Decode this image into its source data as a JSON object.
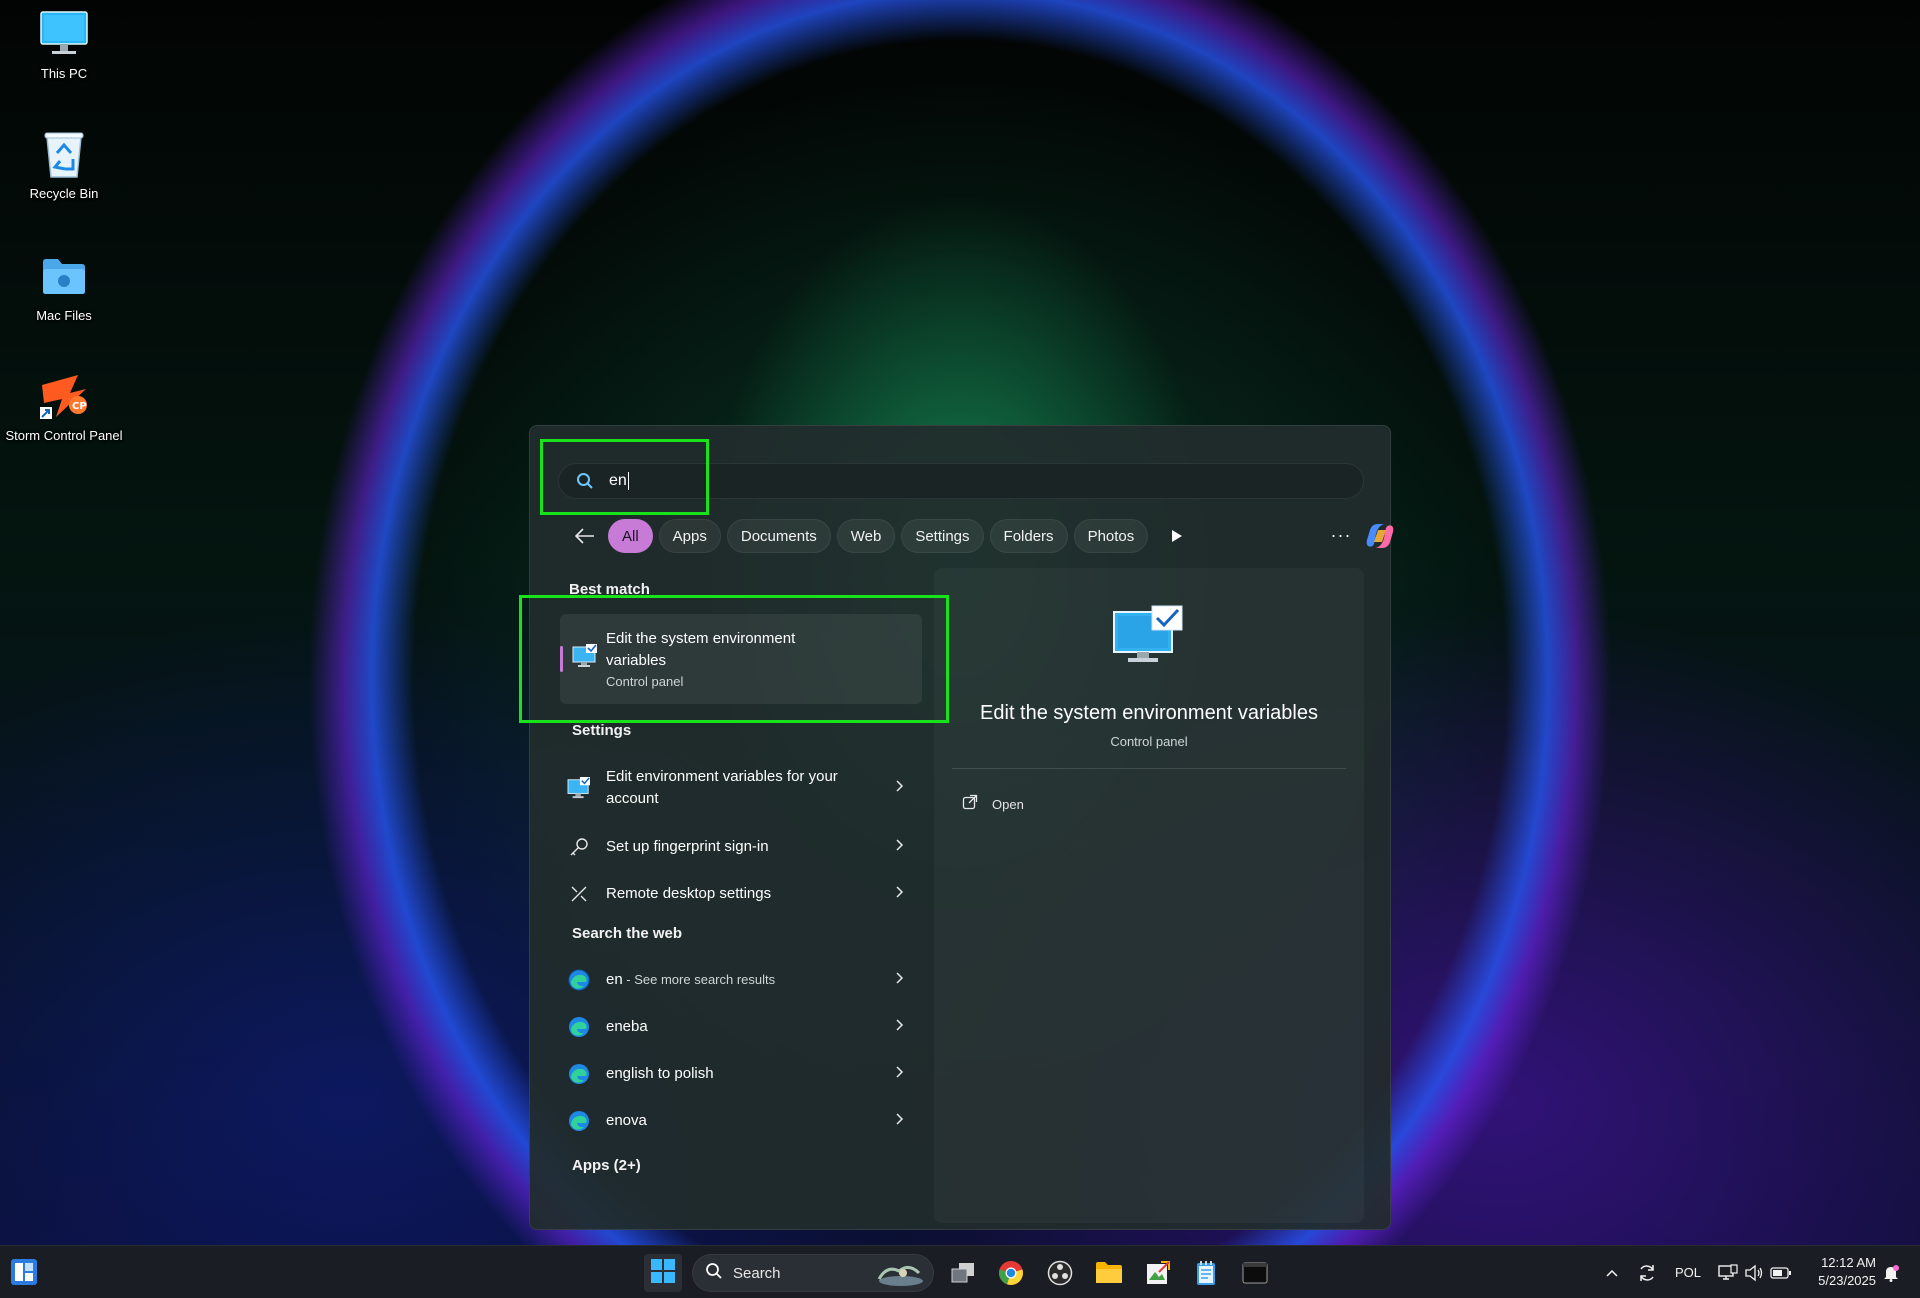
{
  "desktop": {
    "icons": [
      {
        "label": "This PC",
        "icon": "monitor-icon"
      },
      {
        "label": "Recycle Bin",
        "icon": "recycle-bin-icon"
      },
      {
        "label": "Mac Files",
        "icon": "folder-icon"
      },
      {
        "label": "Storm Control Panel",
        "icon": "storm-control-panel-icon"
      }
    ]
  },
  "search": {
    "query": "en",
    "filters": [
      "All",
      "Apps",
      "Documents",
      "Web",
      "Settings",
      "Folders",
      "Photos"
    ],
    "active_filter": "All",
    "more_label": "···"
  },
  "best_match": {
    "section_title": "Best match",
    "title": "Edit the system environment variables",
    "subtitle": "Control panel"
  },
  "settings_section": {
    "title": "Settings",
    "items": [
      {
        "label": "Edit environment variables for your account",
        "icon": "environment-variables-icon"
      },
      {
        "label": "Set up fingerprint sign-in",
        "icon": "key-icon"
      },
      {
        "label": "Remote desktop settings",
        "icon": "remote-desktop-icon"
      }
    ]
  },
  "web_section": {
    "title": "Search the web",
    "items": [
      {
        "label": "en",
        "suffix": " - See more search results",
        "icon": "edge-icon"
      },
      {
        "label": "eneba",
        "suffix": "",
        "icon": "edge-icon"
      },
      {
        "label": "english to polish",
        "suffix": "",
        "icon": "edge-icon"
      },
      {
        "label": "enova",
        "suffix": "",
        "icon": "edge-icon"
      }
    ]
  },
  "apps_section": {
    "title": "Apps (2+)"
  },
  "preview": {
    "title": "Edit the system environment variables",
    "subtitle": "Control panel",
    "open_label": "Open"
  },
  "taskbar": {
    "search_label": "Search",
    "language": "POL",
    "time": "12:12 AM",
    "date": "5/23/2025"
  },
  "colors": {
    "accent": "#c77ad6",
    "highlight": "#18e21b"
  }
}
